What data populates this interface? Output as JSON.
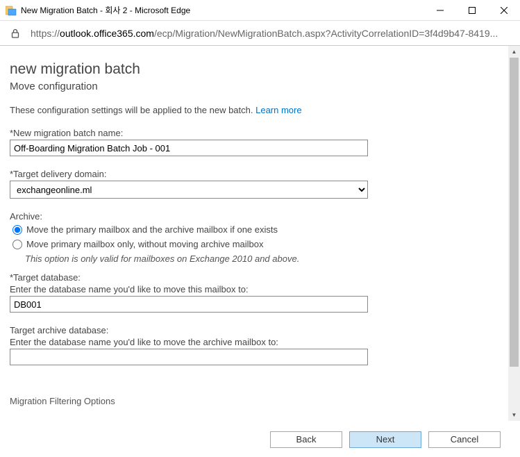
{
  "window": {
    "title": "New Migration Batch - 회사 2 - Microsoft Edge"
  },
  "address": {
    "prefix": "https://",
    "host": "outlook.office365.com",
    "path": "/ecp/Migration/NewMigrationBatch.aspx?ActivityCorrelationID=3f4d9b47-8419..."
  },
  "page": {
    "title": "new migration batch",
    "subtitle": "Move configuration",
    "intro_text": "These configuration settings will be applied to the new batch. ",
    "learn_more": "Learn more"
  },
  "fields": {
    "batch_name": {
      "label": "*New migration batch name:",
      "value": "Off-Boarding Migration Batch Job - 001"
    },
    "target_domain": {
      "label": "*Target delivery domain:",
      "value": "exchangeonline.ml"
    },
    "archive": {
      "label": "Archive:",
      "opt1": "Move the primary mailbox and the archive mailbox if one exists",
      "opt2": "Move primary mailbox only, without moving archive mailbox",
      "note": "This option is only valid for mailboxes on Exchange 2010 and above."
    },
    "target_db": {
      "label": "*Target database:",
      "help": "Enter the database name you'd like to move this mailbox to:",
      "value": "DB001"
    },
    "target_archive_db": {
      "label": "Target archive database:",
      "help": "Enter the database name you'd like to move the archive mailbox to:",
      "value": ""
    },
    "cutoff_heading": "Migration Filtering Options"
  },
  "buttons": {
    "back": "Back",
    "next": "Next",
    "cancel": "Cancel"
  }
}
